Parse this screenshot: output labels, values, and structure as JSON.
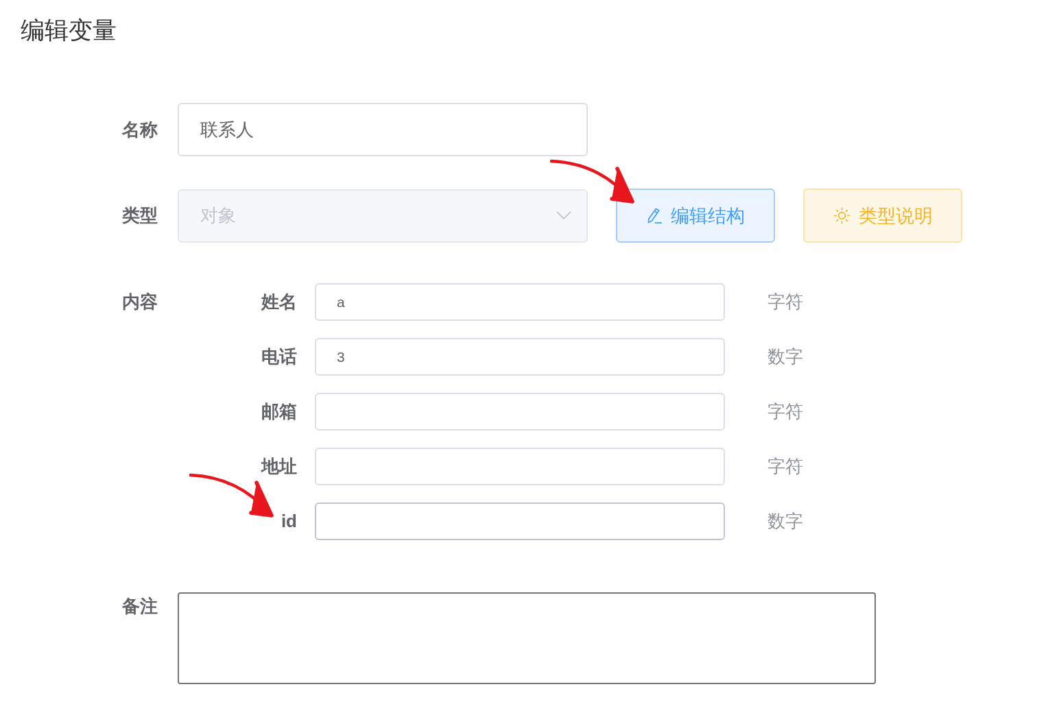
{
  "page_title": "编辑变量",
  "form": {
    "name": {
      "label": "名称",
      "value": "联系人"
    },
    "type": {
      "label": "类型",
      "value": "对象",
      "disabled": true
    },
    "actions": [
      {
        "kind": "edit",
        "label": "编辑结构",
        "marked_by_arrow": true
      },
      {
        "kind": "help",
        "label": "类型说明",
        "marked_by_arrow": false
      }
    ],
    "content": {
      "label": "内容",
      "fields": [
        {
          "label": "姓名",
          "value": "a",
          "type": "字符",
          "hovered": false,
          "marked_by_arrow": false
        },
        {
          "label": "电话",
          "value": "3",
          "type": "数字",
          "hovered": false,
          "marked_by_arrow": false
        },
        {
          "label": "邮箱",
          "type": "字符",
          "hovered": false,
          "marked_by_arrow": false
        },
        {
          "label": "地址",
          "type": "字符",
          "hovered": false,
          "marked_by_arrow": false
        },
        {
          "label": "id",
          "type": "数字",
          "hovered": true,
          "marked_by_arrow": true
        }
      ]
    },
    "remark": {
      "label": "备注"
    }
  }
}
